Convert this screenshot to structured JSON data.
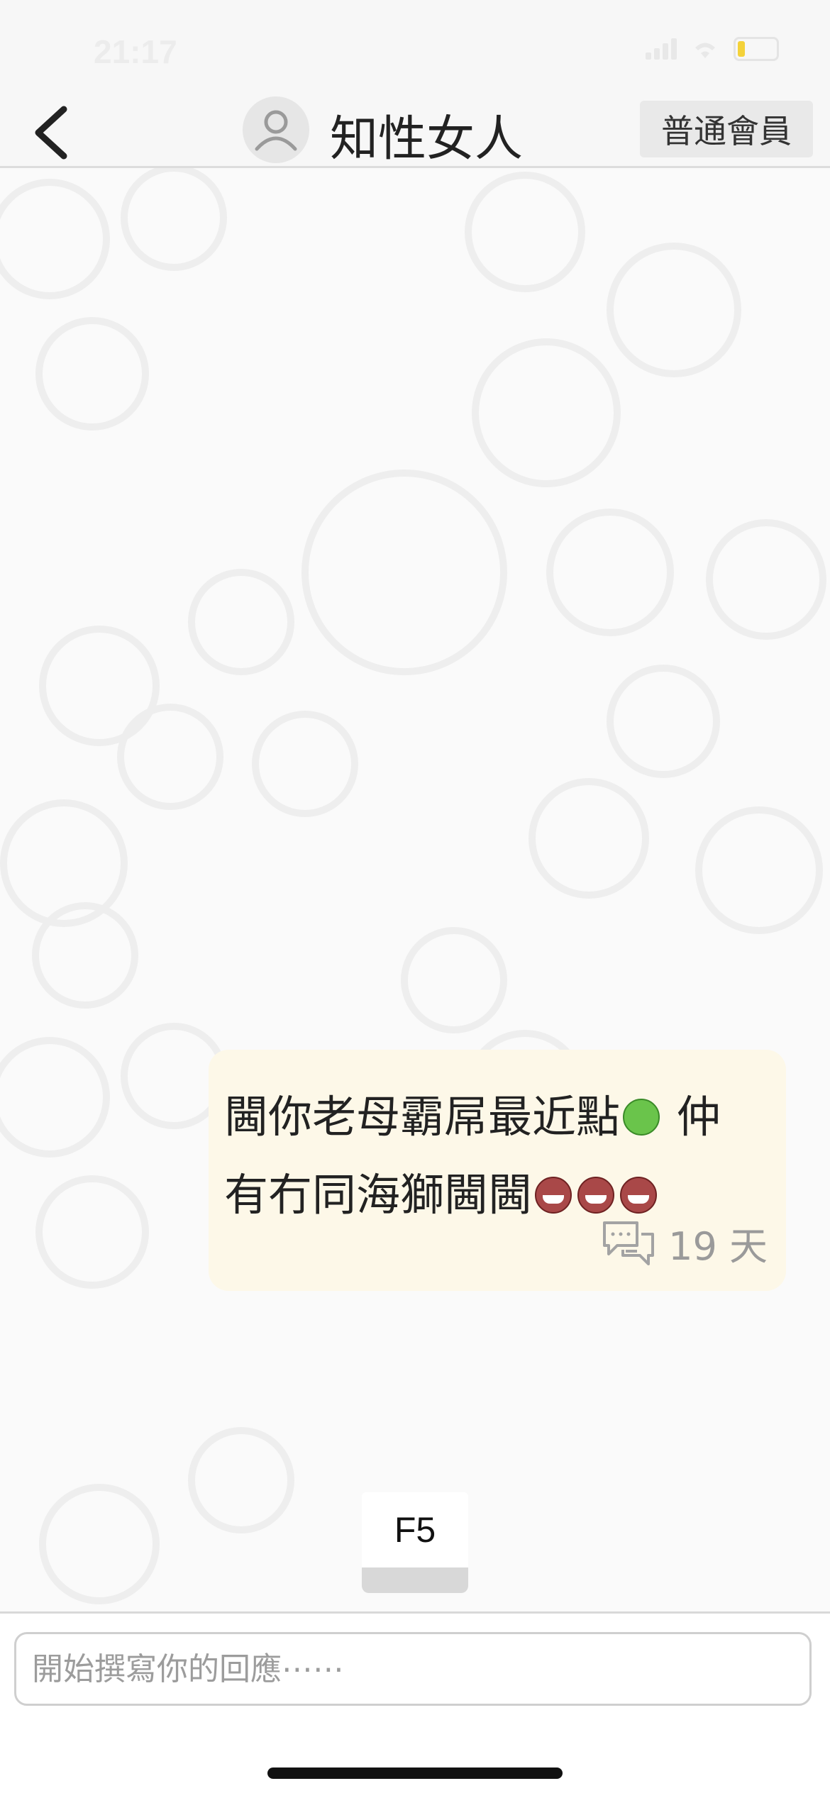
{
  "status_bar": {
    "time": "21:17",
    "battery_color": "#f4d23a"
  },
  "header": {
    "back_icon": "chevron-left-icon",
    "avatar_icon": "user-avatar-icon",
    "title": "知性女人",
    "member_badge": "普通會員"
  },
  "messages": [
    {
      "line1_text": "閪你老母霸屌最近點",
      "line1_tail": "仲",
      "line2_text": "有冇同海獅閪閪",
      "emoji_colors": [
        "#6ac44b",
        "#a94848"
      ],
      "reply_icon": "chat-bubbles-icon",
      "time_ago": "19 天"
    }
  ],
  "f5_button": {
    "label": "F5"
  },
  "composer": {
    "placeholder": "開始撰寫你的回應⋯⋯",
    "value": ""
  }
}
